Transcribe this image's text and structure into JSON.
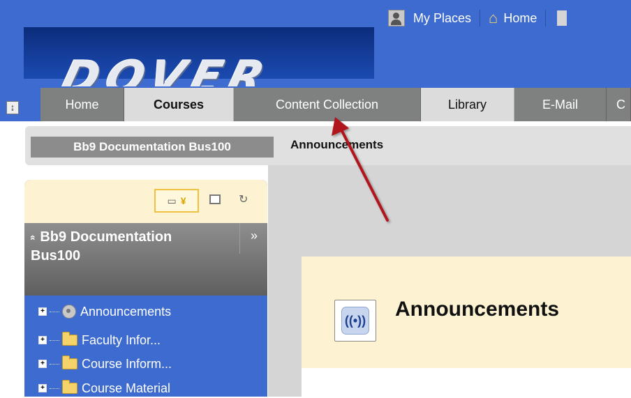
{
  "logo_text": "DOVER",
  "topnav": {
    "my_places": "My Places",
    "home": "Home"
  },
  "tabs": [
    {
      "label": "Home"
    },
    {
      "label": "Courses"
    },
    {
      "label": "Content Collection"
    },
    {
      "label": "Library"
    },
    {
      "label": "E-Mail"
    },
    {
      "label": "C"
    }
  ],
  "breadcrumb": {
    "course": "Bb9 Documentation Bus100",
    "page": "Announcements"
  },
  "sidebar": {
    "course_title": "Bb9 Documentation Bus100",
    "collapse_glyph": "»",
    "expand_glyph": "«",
    "items": [
      {
        "label": "Announcements",
        "icon": "announcements-icon"
      },
      {
        "label": "Faculty Infor...",
        "icon": "folder-icon"
      },
      {
        "label": "Course Inform...",
        "icon": "folder-icon"
      },
      {
        "label": "Course Material",
        "icon": "folder-icon"
      }
    ]
  },
  "main": {
    "heading": "Announcements"
  },
  "colors": {
    "header_blue": "#3e6bcf",
    "cream": "#fdf3d3",
    "arrow_red": "#b0121b"
  }
}
